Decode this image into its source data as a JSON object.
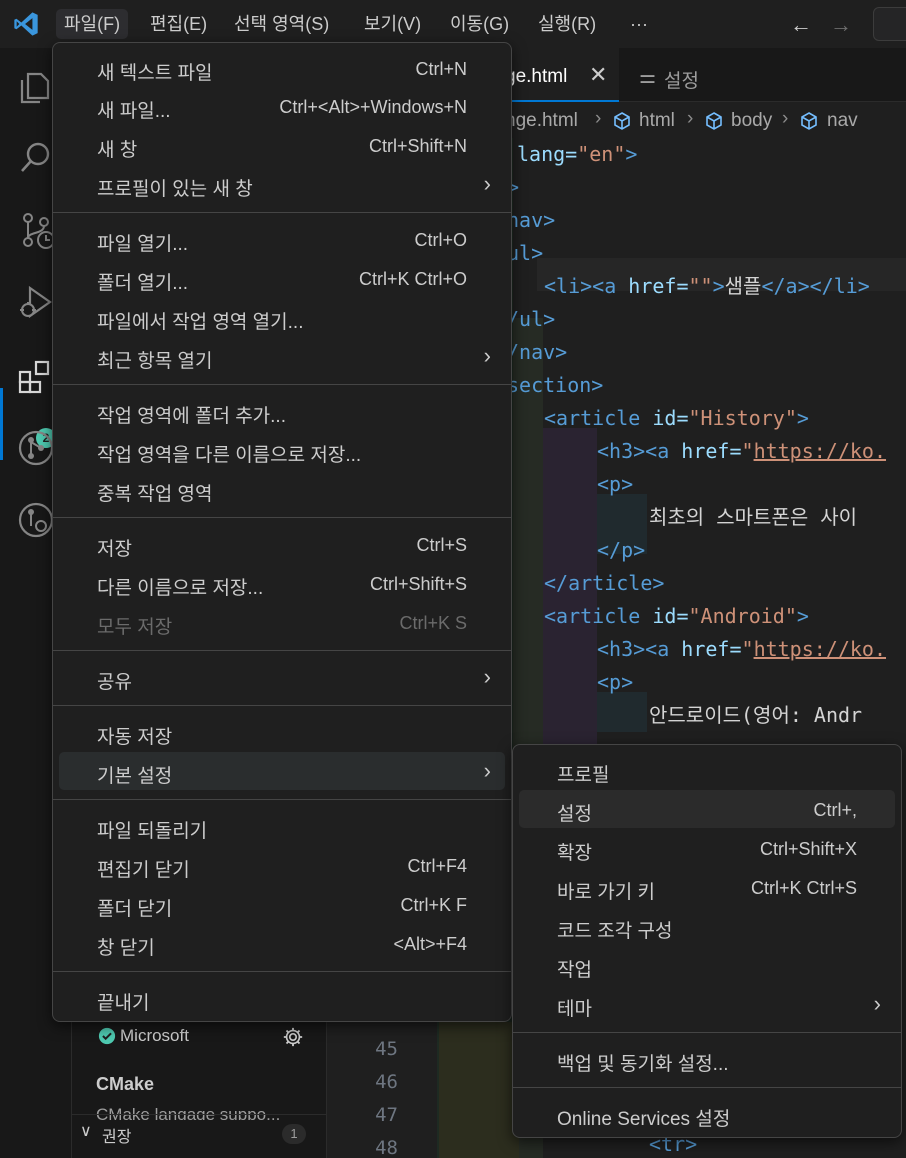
{
  "titlebar": {
    "menus": [
      "파일(F)",
      "편집(E)",
      "선택 영역(S)",
      "보기(V)",
      "이동(G)",
      "실행(R)",
      "···"
    ],
    "active_menu": "파일(F)"
  },
  "activitybar": {
    "icons": [
      "explorer-icon",
      "search-icon",
      "source-control-icon",
      "run-debug-icon",
      "extensions-icon",
      "git-graph-icon",
      "remote-icon"
    ],
    "extensions_badge": "2"
  },
  "sidebar": {
    "publisher": "Microsoft",
    "ext_name": "CMake",
    "ext_desc": "CMake langage suppo...",
    "recommended_label": "권장",
    "recommended_count": "1"
  },
  "editor": {
    "tab_active": "ge.html",
    "tab_settings": "설정",
    "breadcrumb": [
      "nge.html",
      "html",
      "body",
      "nav"
    ],
    "line_numbers": [
      "45",
      "46",
      "47",
      "48"
    ]
  },
  "code": {
    "l1_attr": "lang=",
    "l1_val": "\"en\"",
    "l1_close": ">",
    "l2": ">",
    "l3": "nav>",
    "l4": "ul>",
    "l5_a1": "<li><a ",
    "l5_attr": "href=",
    "l5_val": "\"\"",
    "l5_gt": ">",
    "l5_text": "샘플",
    "l5_close": "</a></li>",
    "l6": "/ul>",
    "l7": "/nav>",
    "l8": "section>",
    "l9_open": "<article ",
    "l9_attr": "id=",
    "l9_val": "\"History\"",
    "l9_gt": ">",
    "l10_open": "<h3><a ",
    "l10_attr": "href=",
    "l10_q": "\"",
    "l10_url": "https://ko.",
    "l11": "<p>",
    "l12_text": "최초의 스마트폰은 사이",
    "l13": "</p>",
    "l14": "</article>",
    "l15_open": "<article ",
    "l15_attr": "id=",
    "l15_val": "\"Android\"",
    "l15_gt": ">",
    "l16_open": "<h3><a ",
    "l16_attr": "href=",
    "l16_q": "\"",
    "l16_url": "https://ko.",
    "l17": "<p>",
    "l18_text": "안드로이드(영어: Andr",
    "l19": "<tr>"
  },
  "file_menu": {
    "items": [
      {
        "label": "새 텍스트 파일",
        "key": "Ctrl+N"
      },
      {
        "label": "새 파일...",
        "key": "Ctrl+<Alt>+Windows+N"
      },
      {
        "label": "새 창",
        "key": "Ctrl+Shift+N"
      },
      {
        "label": "프로필이 있는 새 창",
        "key": ""
      },
      {
        "label": "파일 열기...",
        "key": "Ctrl+O"
      },
      {
        "label": "폴더 열기...",
        "key": "Ctrl+K Ctrl+O"
      },
      {
        "label": "파일에서 작업 영역 열기...",
        "key": ""
      },
      {
        "label": "최근 항목 열기",
        "key": ""
      },
      {
        "label": "작업 영역에 폴더 추가...",
        "key": ""
      },
      {
        "label": "작업 영역을 다른 이름으로 저장...",
        "key": ""
      },
      {
        "label": "중복 작업 영역",
        "key": ""
      },
      {
        "label": "저장",
        "key": "Ctrl+S"
      },
      {
        "label": "다른 이름으로 저장...",
        "key": "Ctrl+Shift+S"
      },
      {
        "label": "모두 저장",
        "key": "Ctrl+K S"
      },
      {
        "label": "공유",
        "key": ""
      },
      {
        "label": "자동 저장",
        "key": ""
      },
      {
        "label": "기본 설정",
        "key": ""
      },
      {
        "label": "파일 되돌리기",
        "key": ""
      },
      {
        "label": "편집기 닫기",
        "key": "Ctrl+F4"
      },
      {
        "label": "폴더 닫기",
        "key": "Ctrl+K F"
      },
      {
        "label": "창 닫기",
        "key": "<Alt>+F4"
      },
      {
        "label": "끝내기",
        "key": ""
      }
    ]
  },
  "preferences_submenu": {
    "items": [
      {
        "label": "프로필",
        "key": ""
      },
      {
        "label": "설정",
        "key": "Ctrl+,"
      },
      {
        "label": "확장",
        "key": "Ctrl+Shift+X"
      },
      {
        "label": "바로 가기 키",
        "key": "Ctrl+K Ctrl+S"
      },
      {
        "label": "코드 조각 구성",
        "key": ""
      },
      {
        "label": "작업",
        "key": ""
      },
      {
        "label": "테마",
        "key": ""
      },
      {
        "label": "백업 및 동기화 설정...",
        "key": ""
      },
      {
        "label": "Online Services 설정",
        "key": ""
      }
    ]
  },
  "colors": {
    "accent": "#0078d4",
    "tag": "#569cd6",
    "attr": "#9cdcfe",
    "string": "#ce9178",
    "menu_bg": "#1f1f1f"
  }
}
